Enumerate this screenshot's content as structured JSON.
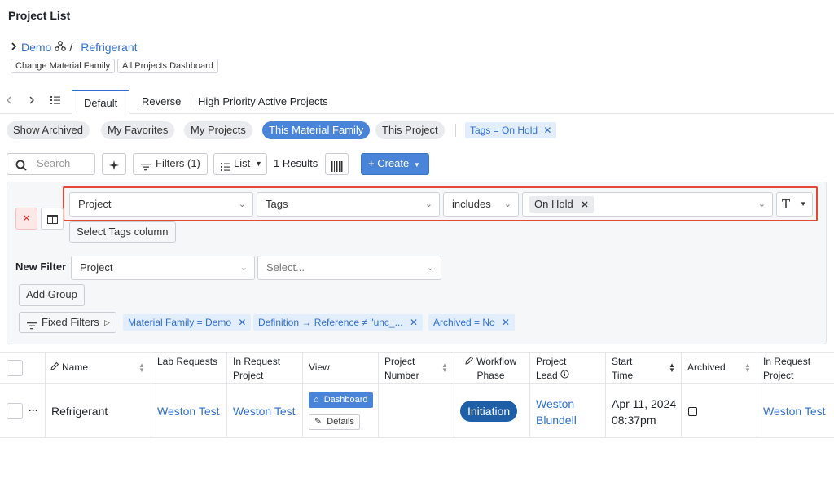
{
  "header": {
    "title": "Project List"
  },
  "breadcrumb": {
    "root": "Demo",
    "sep": "/",
    "current": "Refrigerant"
  },
  "quick_links": [
    "Change Material Family",
    "All Projects Dashboard"
  ],
  "view_tabs": [
    "Default",
    "Reverse",
    "High Priority Active Projects"
  ],
  "preset_filters": [
    "Show Archived",
    "My Favorites",
    "My Projects",
    "This Material Family",
    "This Project"
  ],
  "active_tag_chip": "Tags = On Hold",
  "toolbar": {
    "search_placeholder": "Search",
    "filters_label": "Filters (1)",
    "list_label": "List",
    "results": "1 Results",
    "create_label": "+ Create"
  },
  "filter_row": {
    "entity": "Project",
    "field": "Tags",
    "operator": "includes",
    "value_chip": "On Hold",
    "type_symbol": "T"
  },
  "select_tags_column": "Select Tags column",
  "new_filter": {
    "label": "New Filter",
    "entity": "Project",
    "field_placeholder": "Select..."
  },
  "add_group": "Add Group",
  "fixed_filters": {
    "label": "Fixed Filters",
    "chips": [
      "Material Family = Demo",
      "Definition → Reference ≠ \"unc_...",
      "Archived = No"
    ]
  },
  "table": {
    "headers": {
      "name": "Name",
      "lab_requests": "Lab Requests",
      "in_request_project": "In Request Project",
      "view": "View",
      "project_number": "Project Number",
      "workflow_phase": "Workflow Phase",
      "project_lead": "Project Lead",
      "start_time": "Start Time",
      "archived": "Archived",
      "in_request_project_2": "In Request Project"
    },
    "row": {
      "more": "···",
      "name": "Refrigerant",
      "lab_requests": "Weston Test",
      "in_request_project": "Weston Test",
      "view_dashboard": "Dashboard",
      "view_details": "Details",
      "project_number": "",
      "workflow_phase": "Initiation",
      "project_lead": "Weston Blundell",
      "start_date": "Apr 11, 2024",
      "start_time": "08:37pm",
      "in_request_project_2": "Weston Test"
    }
  },
  "colors": {
    "accent": "#4a84d9",
    "link": "#2f6fcf",
    "highlight": "#e24a33",
    "phase": "#1f5fa8"
  }
}
